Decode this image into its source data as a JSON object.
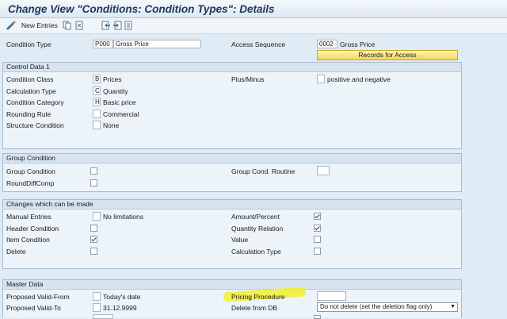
{
  "window": {
    "title": "Change View \"Conditions: Condition Types\": Details"
  },
  "toolbar": {
    "new_entries": "New Entries"
  },
  "header": {
    "condition_type_label": "Condition Type",
    "condition_type_value": "P000",
    "condition_type_desc": "Gross Price",
    "access_sequence_label": "Access Sequence",
    "access_sequence_value": "0002",
    "access_sequence_desc": "Gross Price",
    "records_button": "Records for Access"
  },
  "control_data": {
    "title": "Control Data 1",
    "rows": [
      {
        "label": "Condition Class",
        "code": "B",
        "text": "Prices"
      },
      {
        "label": "Calculation Type",
        "code": "C",
        "text": "Quantity"
      },
      {
        "label": "Condition Category",
        "code": "H",
        "text": "Basic price"
      },
      {
        "label": "Rounding Rule",
        "code": "",
        "text": "Commercial"
      },
      {
        "label": "Structure Condition",
        "code": "",
        "text": "None"
      }
    ],
    "plus_minus_label": "Plus/Minus",
    "plus_minus_text": "positive and negative"
  },
  "group_condition": {
    "title": "Group Condition",
    "group_condition_label": "Group Condition",
    "group_condition_checked": false,
    "round_diff_label": "RoundDiffComp",
    "round_diff_checked": false,
    "group_routine_label": "Group Cond. Routine",
    "group_routine_value": ""
  },
  "changes": {
    "title": "Changes which can be made",
    "manual_entries_label": "Manual Entries",
    "manual_entries_text": "No limitations",
    "header_condition_label": "Header Condition",
    "header_condition_checked": false,
    "item_condition_label": "Item Condition",
    "item_condition_checked": true,
    "delete_label": "Delete",
    "delete_checked": false,
    "amount_percent_label": "Amount/Percent",
    "amount_percent_checked": true,
    "quantity_relation_label": "Quantity Relation",
    "quantity_relation_checked": true,
    "value_label": "Value",
    "value_checked": false,
    "calculation_type_label": "Calculation Type",
    "calculation_type_checked": false
  },
  "master_data": {
    "title": "Master Data",
    "valid_from_label": "Proposed Valid-From",
    "valid_from_text": "Today's date",
    "valid_to_label": "Proposed Valid-To",
    "valid_to_value": "31.12.9999",
    "pricing_procedure_label": "Pricing Procedure",
    "pricing_procedure_value": "",
    "delete_from_db_label": "Delete from DB",
    "delete_from_db_value": "Do not delete (set the deletion flag only)"
  },
  "colors": {
    "highlight": "#f3ef2a",
    "records_button": "#f2d65c",
    "title": "#1c3760"
  }
}
